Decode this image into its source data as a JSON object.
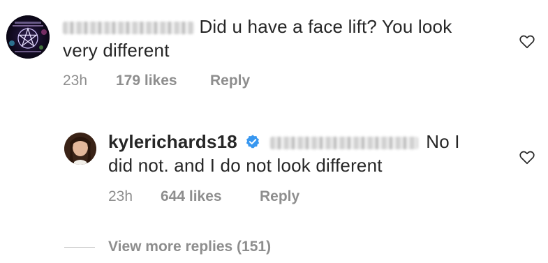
{
  "comment": {
    "text_line1": "Did u have a face lift? You look",
    "text_line2": "very different",
    "time": "23h",
    "likes": "179 likes",
    "reply": "Reply"
  },
  "reply_comment": {
    "username": "kylerichards18",
    "text_line1": "No I",
    "text_line2": "did not. and I do not look different",
    "time": "23h",
    "likes": "644 likes",
    "reply": "Reply"
  },
  "view_more": "View more replies (151)",
  "colors": {
    "verified": "#3897f0",
    "meta": "#8e8e8e"
  }
}
